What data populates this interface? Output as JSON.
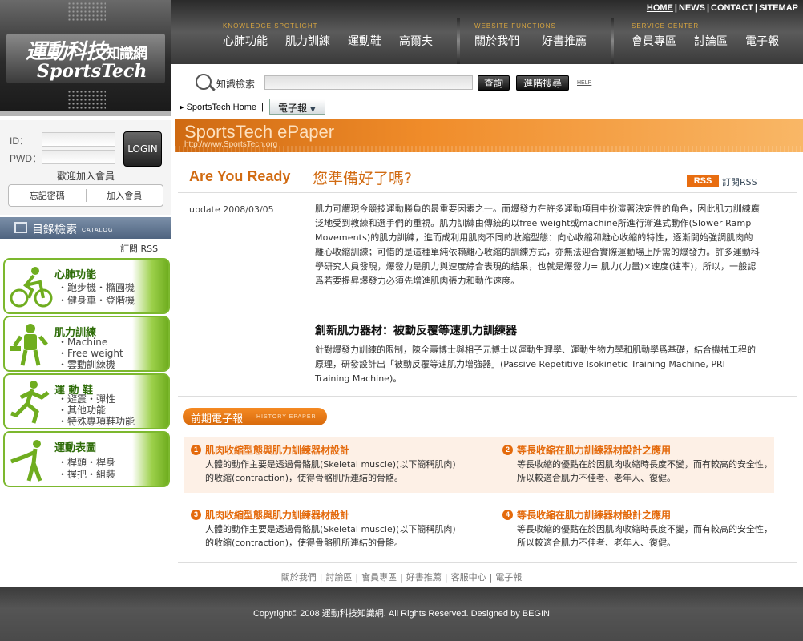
{
  "logo": {
    "cn": "運動科技",
    "cn_small": "知識網",
    "en": "SportsTech"
  },
  "top_links": [
    "HOME",
    "NEWS",
    "CONTACT",
    "SITEMAP"
  ],
  "nav_groups": [
    {
      "caption": "KNOWLEDGE SPOTLIGHT",
      "items": [
        "心肺功能",
        "肌力訓練",
        "運動鞋",
        "高爾夫"
      ]
    },
    {
      "caption": "WEBSITE FUNCTIONS",
      "items": [
        "關於我們",
        "好書推薦"
      ]
    },
    {
      "caption": "SERVICE CENTER",
      "items": [
        "會員專區",
        "討論區",
        "電子報"
      ]
    }
  ],
  "search": {
    "label": "知識檢索",
    "query_btn": "查詢",
    "advanced_btn": "進階搜尋",
    "help": "HELP"
  },
  "crumb": {
    "home": "SportsTech Home",
    "selected": "電子報"
  },
  "banner": {
    "title": "SportsTech ePaper",
    "url": "http://www.SportsTech.org"
  },
  "login": {
    "id_label": "ID：",
    "pwd_label": "PWD：",
    "button": "LOGIN",
    "welcome": "歡迎加入會員",
    "forgot": "忘記密碼",
    "join": "加入會員"
  },
  "catalog": {
    "title": "目錄檢索",
    "caption": "CATALOG",
    "rss": "訂閱 RSS"
  },
  "categories": [
    {
      "title": "心肺功能",
      "lines": [
        "・跑步機・橢圓機",
        "・健身車・登階機"
      ]
    },
    {
      "title": "肌力訓練",
      "lines": [
        "・Machine",
        "・Free weight",
        "・雲動訓練機"
      ]
    },
    {
      "title": "運 動 鞋",
      "lines": [
        "・避震・彈性",
        "・其他功能",
        "・特殊專項鞋功能"
      ]
    },
    {
      "title": "運動表圖",
      "lines": [
        "・桿頭・桿身",
        "・握把・組裝"
      ]
    }
  ],
  "article": {
    "heading_en": "Are You Ready",
    "heading_cn": "您準備好了嗎?",
    "rss_badge": "RSS",
    "rss_sub": "訂閱RSS",
    "update": "update 2008/03/05",
    "intro": "肌力可謂現今競技運動勝負的最重要因素之一。而爆發力在許多運動項目中扮演著決定性的角色，因此肌力訓練廣泛地受到教練和選手們的重視。肌力訓練由傳統的以free weight或machine所進行漸進式動作(Slower Ramp Movements)的肌力訓練，進而成利用肌肉不同的收縮型態：向心收縮和離心收縮的特性，逐漸開始強調肌肉的離心收縮訓練；可惜的是這種單純依賴離心收縮的訓練方式，亦無法迎合實際運動場上所需的爆發力。許多運動科學研究人員發現，爆發力是肌力與速度綜合表現的結果，也就是爆發力= 肌力(力量)×速度(速率)，所以，一般認爲若要提昇爆發力必須先增進肌肉張力和動作速度。",
    "subheading": "創新肌力器材：被動反覆等速肌力訓練器",
    "sub_para": "針對爆發力訓練的限制，陳全壽博士與相子元博士以運動生理學、運動生物力學和肌動學爲基礎，結合機械工程的原理，研發設計出「被動反覆等速肌力增強器」(Passive Repetitive Isokinetic Training Machine, PRI Training Machine)。"
  },
  "past": {
    "title": "前期電子報",
    "caption": "HISTORY EPAPER",
    "items": [
      {
        "num": "1",
        "title": "肌肉收縮型態與肌力訓練器材設計",
        "text": "人體的動作主要是透過骨骼肌(Skeletal muscle)(以下簡稱肌肉)的收縮(contraction)，使得骨骼肌所連結的骨骼。"
      },
      {
        "num": "2",
        "title": "等長收縮在肌力訓練器材設計之應用",
        "text": "等長收縮的優點在於因肌肉收縮時長度不變，而有較高的安全性，所以較適合肌力不佳者、老年人、復健。"
      },
      {
        "num": "3",
        "title": "肌肉收縮型態與肌力訓練器材設計",
        "text": "人體的動作主要是透過骨骼肌(Skeletal muscle)(以下簡稱肌肉)的收縮(contraction)，使得骨骼肌所連結的骨骼。"
      },
      {
        "num": "4",
        "title": "等長收縮在肌力訓練器材設計之應用",
        "text": "等長收縮的優點在於因肌肉收縮時長度不變，而有較高的安全性，所以較適合肌力不佳者、老年人、復健。"
      }
    ]
  },
  "footer_nav": [
    "關於我們",
    "討論區",
    "會員專區",
    "好書推薦",
    "客服中心",
    "電子報"
  ],
  "copyright": "Copyright© 2008 運動科技知識網. All Rights Reserved. Designed by BEGIN"
}
